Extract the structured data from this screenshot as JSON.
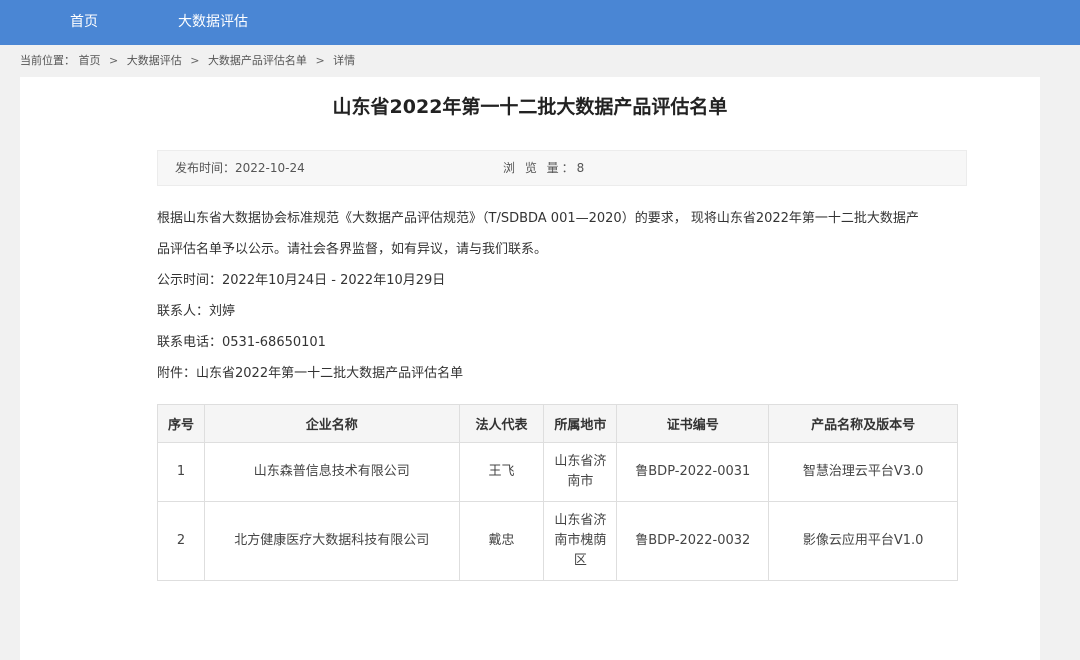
{
  "nav": {
    "home": "首页",
    "bigdata": "大数据评估"
  },
  "breadcrumb": {
    "prefix": "当前位置：",
    "items": [
      "首页",
      "大数据评估",
      "大数据产品评估名单",
      "详情"
    ],
    "separator": ">"
  },
  "article": {
    "title": "山东省2022年第一十二批大数据产品评估名单",
    "published_label": "发布时间：",
    "published_value": "2022-10-24",
    "views_label": "浏 览 量：",
    "views_value": "8",
    "paragraphs": [
      "根据山东省大数据协会标准规范《大数据产品评估规范》（T/SDBDA 001—2020）的要求， 现将山东省2022年第一十二批大数据产",
      "品评估名单予以公示。请社会各界监督，如有异议，请与我们联系。",
      "公示时间：2022年10月24日 - 2022年10月29日",
      "联系人：刘婷",
      "联系电话：0531-68650101",
      "附件：山东省2022年第一十二批大数据产品评估名单"
    ]
  },
  "table": {
    "headers": [
      "序号",
      "企业名称",
      "法人代表",
      "所属地市",
      "证书编号",
      "产品名称及版本号"
    ],
    "rows": [
      [
        "1",
        "山东森普信息技术有限公司",
        "王飞",
        "山东省济南市",
        "鲁BDP-2022-0031",
        "智慧治理云平台V3.0"
      ],
      [
        "2",
        "北方健康医疗大数据科技有限公司",
        "戴忠",
        "山东省济南市槐荫区",
        "鲁BDP-2022-0032",
        "影像云应用平台V1.0"
      ]
    ]
  }
}
